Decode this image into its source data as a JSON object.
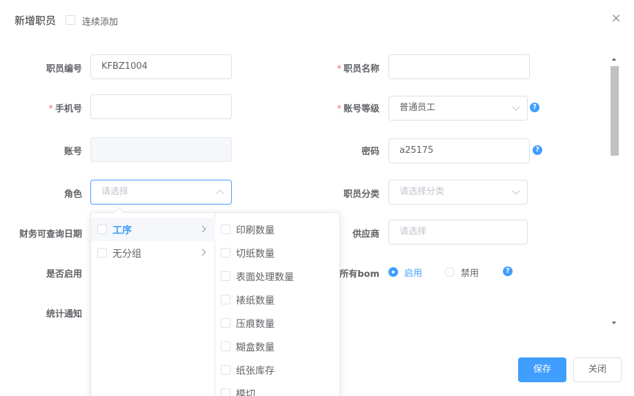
{
  "dialog": {
    "title": "新增职员",
    "continuous_add_label": "连续添加",
    "close_icon": "close-icon"
  },
  "form": {
    "staff_no": {
      "label": "职员编号",
      "value": "KFBZ1004"
    },
    "staff_name": {
      "label": "职员名称",
      "required": true,
      "value": ""
    },
    "phone": {
      "label": "手机号",
      "required": true,
      "value": ""
    },
    "account_level": {
      "label": "账号等级",
      "required": true,
      "value": "普通员工"
    },
    "account": {
      "label": "账号",
      "value": ""
    },
    "password": {
      "label": "密码",
      "value": "a25175"
    },
    "role": {
      "label": "角色",
      "placeholder": "请选择"
    },
    "staff_category": {
      "label": "职员分类",
      "placeholder": "请选择分类"
    },
    "finance_query_date": {
      "label": "财务可查询日期"
    },
    "supplier": {
      "label": "供应商",
      "placeholder": "请选择"
    },
    "enabled": {
      "label": "是否启用"
    },
    "all_bom": {
      "label": "所有bom",
      "options": [
        "启用",
        "禁用"
      ],
      "selected": "启用"
    },
    "stat_notify": {
      "label": "统计通知"
    },
    "help_icon": "?"
  },
  "cascader": {
    "panel1": [
      {
        "label": "工序",
        "active": true
      },
      {
        "label": "无分组",
        "active": false
      }
    ],
    "panel2": [
      "印刷数量",
      "切纸数量",
      "表面处理数量",
      "裱纸数量",
      "压痕数量",
      "糊盒数量",
      "纸张库存",
      "模切"
    ]
  },
  "footer": {
    "save_label": "保存",
    "close_label": "关闭"
  },
  "colors": {
    "primary": "#409eff",
    "required": "#f56c6c"
  }
}
